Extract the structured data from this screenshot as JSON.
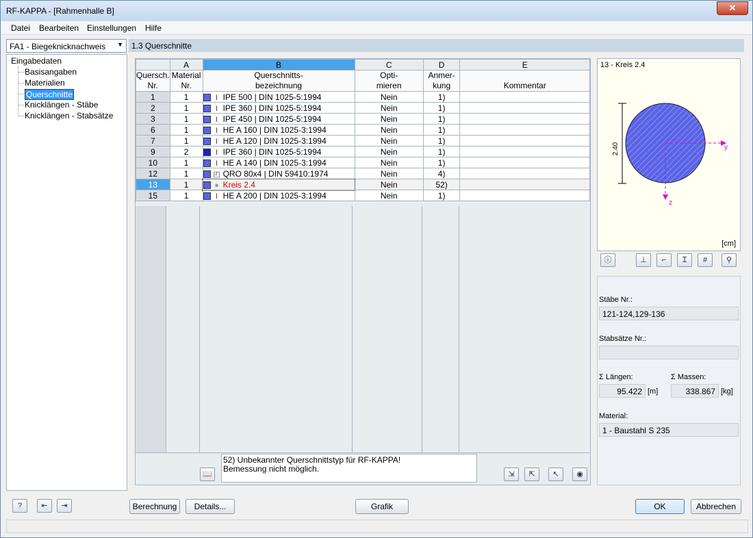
{
  "window": {
    "title": "RF-KAPPA - [Rahmenhalle B]",
    "close_glyph": "✕"
  },
  "menu": [
    "Datei",
    "Bearbeiten",
    "Einstellungen",
    "Hilfe"
  ],
  "case_selector": {
    "value": "FA1 - Biegeknicknachweis"
  },
  "tree": {
    "root": "Eingabedaten",
    "items": [
      "Basisangaben",
      "Materialien",
      "Querschnitte",
      "Knicklängen - Stäbe",
      "Knicklängen - Stabsätze"
    ],
    "selected": "Querschnitte"
  },
  "panel": {
    "title": "1.3 Querschnitte"
  },
  "table": {
    "col_letters": [
      "A",
      "B",
      "C",
      "D",
      "E"
    ],
    "headers": {
      "rowno": [
        "Quersch.",
        "Nr."
      ],
      "A": [
        "Material",
        "Nr."
      ],
      "B": [
        "Querschnitts-",
        "bezeichnung"
      ],
      "C": [
        "Opti-",
        "mieren"
      ],
      "D": [
        "Anmer-",
        "kung"
      ],
      "E": [
        "",
        "Kommentar"
      ]
    },
    "rows": [
      {
        "no": "1",
        "mat": "1",
        "swatch": "#5b63e8",
        "icon": "I",
        "name": "IPE 500 | DIN 1025-5:1994",
        "opt": "Nein",
        "note": "1)",
        "comment": ""
      },
      {
        "no": "2",
        "mat": "1",
        "swatch": "#5b63e8",
        "icon": "I",
        "name": "IPE 360 | DIN 1025-5:1994",
        "opt": "Nein",
        "note": "1)",
        "comment": ""
      },
      {
        "no": "3",
        "mat": "1",
        "swatch": "#5b63e8",
        "icon": "I",
        "name": "IPE 450 | DIN 1025-5:1994",
        "opt": "Nein",
        "note": "1)",
        "comment": ""
      },
      {
        "no": "6",
        "mat": "1",
        "swatch": "#5b63e8",
        "icon": "I",
        "name": "HE A 160 | DIN 1025-3:1994",
        "opt": "Nein",
        "note": "1)",
        "comment": ""
      },
      {
        "no": "7",
        "mat": "1",
        "swatch": "#5b63e8",
        "icon": "I",
        "name": "HE A 120 | DIN 1025-3:1994",
        "opt": "Nein",
        "note": "1)",
        "comment": ""
      },
      {
        "no": "9",
        "mat": "2",
        "swatch": "#1a22c8",
        "icon": "I",
        "name": "IPE 360 | DIN 1025-5:1994",
        "opt": "Nein",
        "note": "1)",
        "comment": ""
      },
      {
        "no": "10",
        "mat": "1",
        "swatch": "#5b63e8",
        "icon": "I",
        "name": "HE A 140 | DIN 1025-3:1994",
        "opt": "Nein",
        "note": "1)",
        "comment": ""
      },
      {
        "no": "12",
        "mat": "1",
        "swatch": "#5b63e8",
        "icon": "◰",
        "name": "QRO 80x4 | DIN 59410:1974",
        "opt": "Nein",
        "note": "4)",
        "comment": ""
      },
      {
        "no": "13",
        "mat": "1",
        "swatch": "#5b63e8",
        "icon": "●",
        "name": "Kreis 2.4",
        "opt": "Nein",
        "note": "52)",
        "comment": "",
        "selected": true
      },
      {
        "no": "15",
        "mat": "1",
        "swatch": "#5b63e8",
        "icon": "I",
        "name": "HE A 200 | DIN 1025-3:1994",
        "opt": "Nein",
        "note": "1)",
        "comment": ""
      }
    ],
    "note_lines": [
      "52) Unbekannter Querschnittstyp für RF-KAPPA!",
      "Bemessung nicht möglich."
    ]
  },
  "preview": {
    "title": "13 - Kreis 2.4",
    "dim_label": "2.40",
    "axis_y": "y",
    "axis_z": "z",
    "unit": "[cm]",
    "fill_color": "#5a63e6"
  },
  "props": {
    "staebe_label": "Stäbe Nr.:",
    "staebe_value": "121-124,129-136",
    "stabsaetze_label": "Stabsätze Nr.:",
    "stabsaetze_value": "",
    "laengen_label": "Σ Längen:",
    "laengen_value": "95.422",
    "laengen_unit": "[m]",
    "massen_label": "Σ Massen:",
    "massen_value": "338.867",
    "massen_unit": "[kg]",
    "material_label": "Material:",
    "material_value": "1 - Baustahl S 235"
  },
  "buttons": {
    "berechnung": "Berechnung",
    "details": "Details...",
    "grafik": "Grafik",
    "ok": "OK",
    "abbrechen": "Abbrechen"
  }
}
